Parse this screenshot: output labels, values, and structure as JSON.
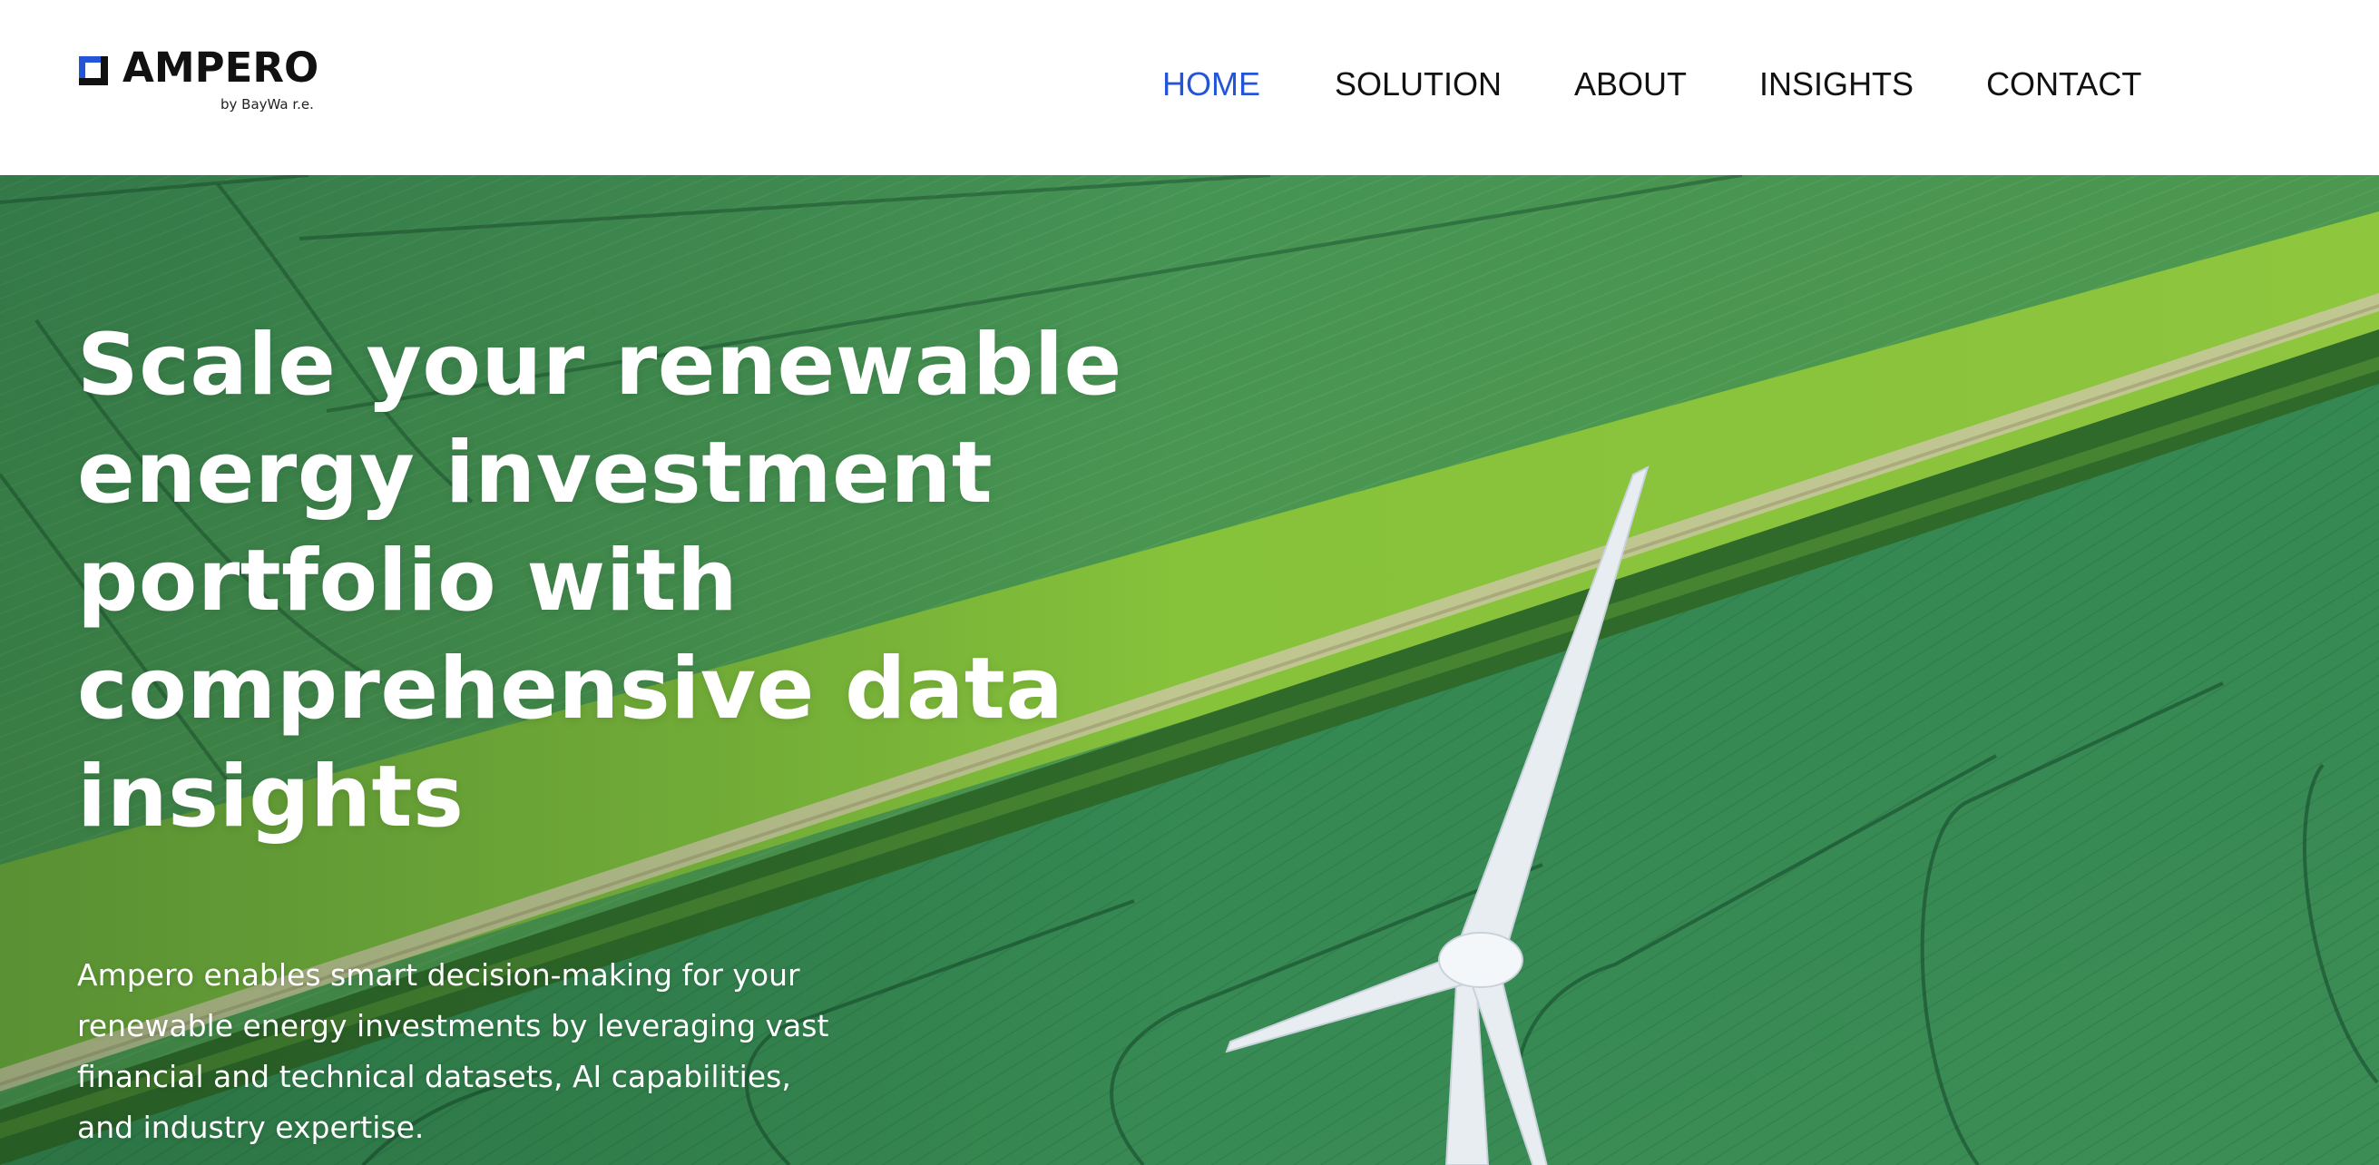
{
  "brand": {
    "name": "AMPERO",
    "byline": "by BayWa r.e.",
    "accent_color": "#2455d6"
  },
  "nav": {
    "items": [
      {
        "label": "HOME",
        "active": true
      },
      {
        "label": "SOLUTION",
        "active": false
      },
      {
        "label": "ABOUT",
        "active": false
      },
      {
        "label": "INSIGHTS",
        "active": false
      },
      {
        "label": "CONTACT",
        "active": false
      }
    ]
  },
  "hero": {
    "title": "Scale your renewable energy investment portfolio with comprehensive data insights",
    "description": "Ampero enables smart decision-making for your renewable energy investments by leveraging vast financial and technical datasets, AI capabilities, and industry expertise.",
    "image": "aerial-green-fields-wind-turbine"
  }
}
